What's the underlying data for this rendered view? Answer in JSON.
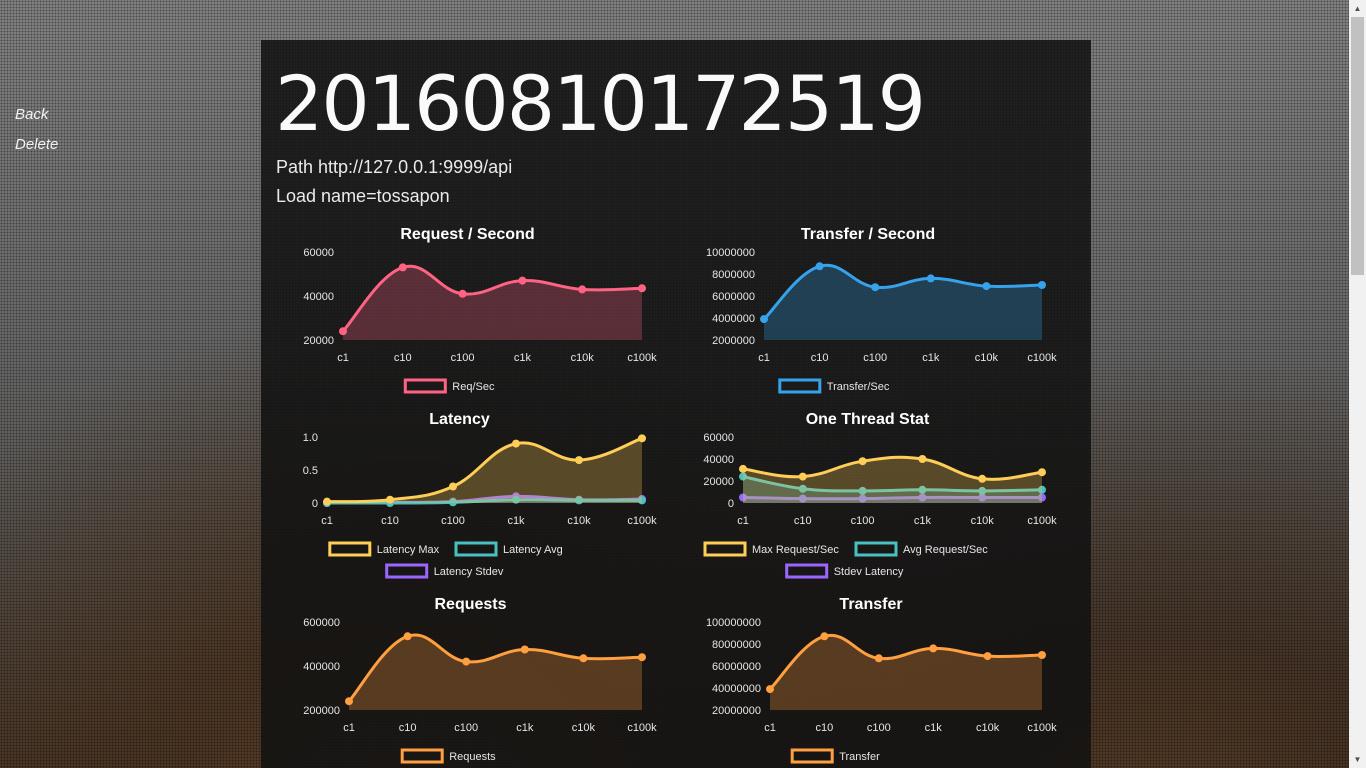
{
  "nav": {
    "back_label": "Back",
    "delete_label": "Delete"
  },
  "header": {
    "title": "20160810172519",
    "path_text": "Path http://127.0.0.1:9999/api",
    "load_text": "Load name=tossapon"
  },
  "chart_data": [
    {
      "id": "rps",
      "type": "area",
      "title": "Request / Second",
      "x": [
        "c1",
        "c10",
        "c100",
        "c1k",
        "c10k",
        "c100k"
      ],
      "yticks": [
        "60000",
        "40000",
        "20000"
      ],
      "ylim": [
        20000,
        60000
      ],
      "series": [
        {
          "name": "Req/Sec",
          "color": "#ff6384",
          "values": [
            24000,
            53000,
            41000,
            47000,
            43000,
            43500
          ]
        }
      ]
    },
    {
      "id": "tps",
      "type": "area",
      "title": "Transfer / Second",
      "x": [
        "c1",
        "c10",
        "c100",
        "c1k",
        "c10k",
        "c100k"
      ],
      "yticks": [
        "10000000",
        "8000000",
        "6000000",
        "4000000",
        "2000000"
      ],
      "ylim": [
        2000000,
        10000000
      ],
      "series": [
        {
          "name": "Transfer/Sec",
          "color": "#36a2eb",
          "values": [
            3900000,
            8700000,
            6800000,
            7600000,
            6900000,
            7000000
          ]
        }
      ]
    },
    {
      "id": "latency",
      "type": "area",
      "title": "Latency",
      "x": [
        "c1",
        "c10",
        "c100",
        "c1k",
        "c10k",
        "c100k"
      ],
      "yticks": [
        "1.0",
        "0.5",
        "0"
      ],
      "ylim": [
        0,
        1.0
      ],
      "series": [
        {
          "name": "Latency Max",
          "color": "#ffce56",
          "values": [
            0.02,
            0.05,
            0.25,
            0.9,
            0.65,
            0.98
          ]
        },
        {
          "name": "Latency Avg",
          "color": "#4bc0c0",
          "values": [
            0.0,
            0.0,
            0.01,
            0.05,
            0.04,
            0.04
          ]
        },
        {
          "name": "Latency Stdev",
          "color": "#9966ff",
          "values": [
            0.0,
            0.01,
            0.02,
            0.1,
            0.05,
            0.06
          ]
        }
      ]
    },
    {
      "id": "thread",
      "type": "area",
      "title": "One Thread Stat",
      "x": [
        "c1",
        "c10",
        "c100",
        "c1k",
        "c10k",
        "c100k"
      ],
      "yticks": [
        "60000",
        "40000",
        "20000",
        "0"
      ],
      "ylim": [
        0,
        60000
      ],
      "series": [
        {
          "name": "Max Request/Sec",
          "color": "#ffce56",
          "values": [
            31000,
            24000,
            38000,
            40000,
            22000,
            28000
          ]
        },
        {
          "name": "Avg Request/Sec",
          "color": "#4bc0c0",
          "values": [
            24000,
            13000,
            11000,
            12000,
            11000,
            12000
          ]
        },
        {
          "name": "Stdev Latency",
          "color": "#9966ff",
          "values": [
            5000,
            4000,
            4000,
            5000,
            5000,
            5000
          ]
        }
      ]
    },
    {
      "id": "requests",
      "type": "area",
      "title": "Requests",
      "x": [
        "c1",
        "c10",
        "c100",
        "c1k",
        "c10k",
        "c100k"
      ],
      "yticks": [
        "600000",
        "400000",
        "200000"
      ],
      "ylim": [
        200000,
        600000
      ],
      "series": [
        {
          "name": "Requests",
          "color": "#ff9f40",
          "values": [
            240000,
            535000,
            420000,
            475000,
            435000,
            440000
          ]
        }
      ]
    },
    {
      "id": "transfer",
      "type": "area",
      "title": "Transfer",
      "x": [
        "c1",
        "c10",
        "c100",
        "c1k",
        "c10k",
        "c100k"
      ],
      "yticks": [
        "100000000",
        "80000000",
        "60000000",
        "40000000",
        "20000000"
      ],
      "ylim": [
        20000000,
        100000000
      ],
      "series": [
        {
          "name": "Transfer",
          "color": "#ff9f40",
          "values": [
            39000000,
            87000000,
            67000000,
            76000000,
            69000000,
            70000000
          ]
        }
      ]
    }
  ],
  "scrollbar": {
    "up_icon": "triangle-up-icon",
    "down_icon": "triangle-down-icon"
  }
}
